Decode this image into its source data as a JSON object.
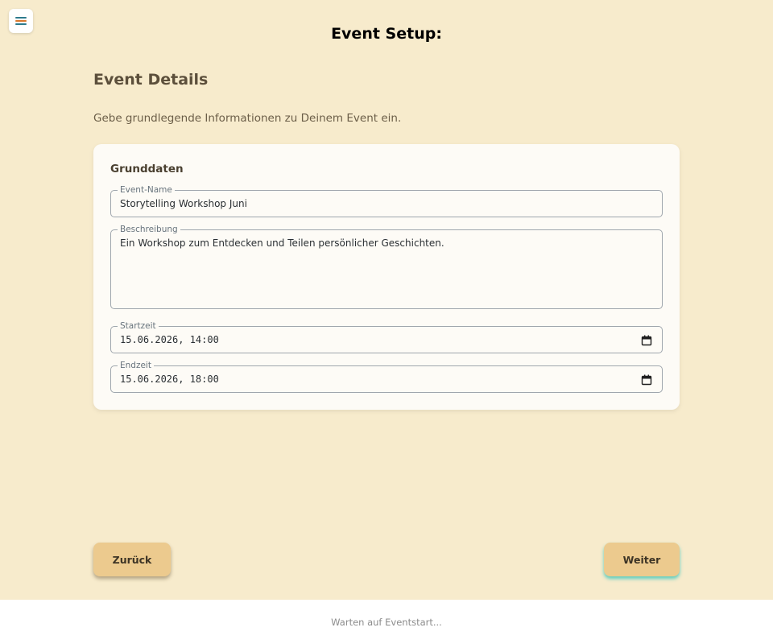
{
  "header": {
    "menu_icon": "hamburger-menu-icon",
    "title": "Event Setup:"
  },
  "section": {
    "title": "Event Details",
    "description": "Gebe grundlegende Informationen zu Deinem Event ein."
  },
  "card": {
    "title": "Grunddaten",
    "fields": {
      "name": {
        "label": "Event-Name",
        "value": "Storytelling Workshop Juni"
      },
      "description": {
        "label": "Beschreibung",
        "value": "Ein Workshop zum Entdecken und Teilen persönlicher Geschichten."
      },
      "start": {
        "label": "Startzeit",
        "value": "15.06.2026, 14:00",
        "icon": "calendar-icon"
      },
      "end": {
        "label": "Endzeit",
        "value": "15.06.2026, 18:00",
        "icon": "calendar-icon"
      }
    }
  },
  "nav": {
    "back_label": "Zurück",
    "next_label": "Weiter"
  },
  "footer": {
    "status": "Warten auf Eventstart..."
  },
  "colors": {
    "background": "#f7ebcc",
    "card": "#fdfbf6",
    "button": "#ecca8e",
    "next_glow": "#40c8be",
    "menu_line_1": "#d9772e",
    "menu_line_2": "#2c7a8c"
  }
}
